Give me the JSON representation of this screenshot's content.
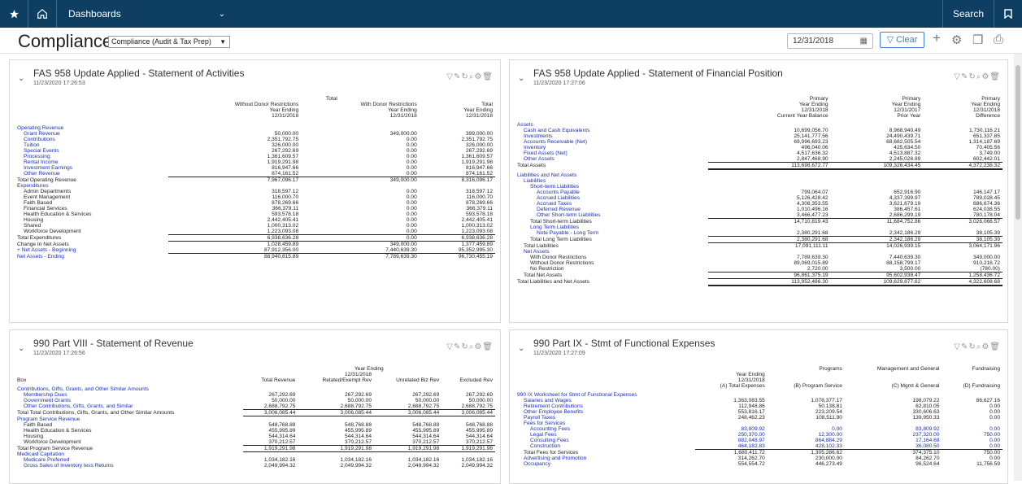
{
  "topbar": {
    "star_icon": "star-icon",
    "home_icon": "home-icon",
    "menu_label": "Dashboards",
    "menu_caret": "⌄",
    "search_label": "Search",
    "bookmark_icon": "bookmark-icon"
  },
  "header": {
    "title": "Compliance",
    "title_caret": "⌄",
    "dashboard_select": "Compliance (Audit & Tax Prep)",
    "date": "12/31/2018",
    "clear_label": "Clear",
    "icons": [
      "add-icon",
      "settings-icon",
      "copy-icon",
      "print-icon"
    ]
  },
  "panels": [
    {
      "title": "FAS 958 Update Applied - Statement of Activities",
      "timestamp": "11/23/2020 17:26:53",
      "group_header": "Total",
      "headers": [
        [
          "",
          "Without Donor Restrictions",
          "With Donor Restrictions",
          "Total"
        ],
        [
          "",
          "Year Ending",
          "Year Ending",
          "Year Ending"
        ],
        [
          "",
          "12/31/2018",
          "12/31/2018",
          "12/31/2018"
        ]
      ],
      "rows": [
        {
          "c": [
            "",
            "",
            " ",
            ""
          ],
          "gap": true
        },
        {
          "c": [
            "Operating Revenue",
            "",
            "",
            ""
          ],
          "i": 0,
          "l": true
        },
        {
          "c": [
            "Grant Revenue",
            "50,000.00",
            "349,000.00",
            "399,000.00"
          ],
          "i": 1,
          "l": true
        },
        {
          "c": [
            "Contributions",
            "2,351,792.75",
            "0.00",
            "2,351,792.75"
          ],
          "i": 1,
          "l": true
        },
        {
          "c": [
            "Tuition",
            "326,000.00",
            "0.00",
            "326,000.00"
          ],
          "i": 1,
          "l": true
        },
        {
          "c": [
            "Special Events",
            "267,292.69",
            "0.00",
            "267,292.69"
          ],
          "i": 1,
          "l": true
        },
        {
          "c": [
            "Processing",
            "1,361,609.57",
            "0.00",
            "1,361,609.57"
          ],
          "i": 1,
          "l": true
        },
        {
          "c": [
            "Rental Income",
            "1,919,291.98",
            "0.00",
            "1,919,291.98"
          ],
          "i": 1,
          "l": true
        },
        {
          "c": [
            "Investment Earnings",
            "816,947.66",
            "0.00",
            "816,947.66"
          ],
          "i": 1,
          "l": true
        },
        {
          "c": [
            "Other Revenue",
            "874,161.52",
            "0.00",
            "874,161.52"
          ],
          "i": 1,
          "l": true,
          "ul": true
        },
        {
          "c": [
            "Total Operating Revenue",
            "7,967,096.17",
            "349,000.00",
            "8,316,096.17"
          ],
          "i": 0
        },
        {
          "c": [
            "Expenditures",
            "",
            "",
            ""
          ],
          "i": 0,
          "l": true
        },
        {
          "c": [
            "Admin Departments",
            "318,597.12",
            "0.00",
            "318,597.12"
          ],
          "i": 1
        },
        {
          "c": [
            "Event Management",
            "116,000.70",
            "0.00",
            "116,000.70"
          ],
          "i": 1
        },
        {
          "c": [
            "Faith Based",
            "878,269.66",
            "0.00",
            "878,269.66"
          ],
          "i": 1
        },
        {
          "c": [
            "Financial Services",
            "366,379.11",
            "0.00",
            "366,379.11"
          ],
          "i": 1
        },
        {
          "c": [
            "Health Education & Services",
            "593,578.18",
            "0.00",
            "593,578.18"
          ],
          "i": 1
        },
        {
          "c": [
            "Housing",
            "2,442,405.41",
            "0.00",
            "2,442,405.41"
          ],
          "i": 1
        },
        {
          "c": [
            "Shared",
            "1,000,313.02",
            "0.00",
            "1,000,313.02"
          ],
          "i": 1
        },
        {
          "c": [
            "Workforce Development",
            "1,223,093.08",
            "0.00",
            "1,223,093.08"
          ],
          "i": 1,
          "ul": true
        },
        {
          "c": [
            "Total Expenditures",
            "6,938,636.28",
            "0.00",
            "6,938,636.28"
          ],
          "i": 0,
          "ul": true
        },
        {
          "c": [
            "Change In Net Assets",
            "1,028,459.89",
            "349,000.00",
            "1,377,459.89"
          ],
          "i": 0
        },
        {
          "c": [
            "+ Net Assets - Beginning",
            "87,912,356.00",
            "7,440,639.30",
            "95,352,995.30"
          ],
          "i": 0,
          "l": true,
          "ul": true
        },
        {
          "c": [
            "Net Assets - Ending",
            "88,940,815.89",
            "7,789,639.30",
            "96,730,455.19"
          ],
          "i": 0,
          "l": true
        }
      ]
    },
    {
      "title": "FAS 958 Update Applied - Statement of Financial Position",
      "timestamp": "11/23/2020 17:27:06",
      "group_header": "",
      "headers": [
        [
          "",
          "Primary",
          "Primary",
          "Primary"
        ],
        [
          "",
          "Year Ending",
          "Year Ending",
          "Year Ending"
        ],
        [
          "",
          "12/31/2018",
          "12/31/2017",
          "12/31/2018"
        ],
        [
          "",
          "Current Year Balance",
          "Prior Year",
          "Difference"
        ]
      ],
      "rows": [
        {
          "c": [
            "Assets",
            "",
            "",
            ""
          ],
          "i": 0,
          "l": true
        },
        {
          "c": [
            "Cash and Cash Equivalents",
            "10,699,056.70",
            "8,968,940.49",
            "1,730,116.21"
          ],
          "i": 1,
          "l": true
        },
        {
          "c": [
            "Investments",
            "25,141,777.56",
            "24,490,439.71",
            "651,337.85"
          ],
          "i": 1,
          "l": true
        },
        {
          "c": [
            "Accounts Receivable (Net)",
            "69,996,693.23",
            "68,682,505.54",
            "1,314,187.69"
          ],
          "i": 1,
          "l": true
        },
        {
          "c": [
            "Inventory",
            "496,040.06",
            "425,634.50",
            "70,405.56"
          ],
          "i": 1,
          "l": true
        },
        {
          "c": [
            "Fixed Assets (Net)",
            "4,517,636.32",
            "4,513,887.32",
            "3,749.00"
          ],
          "i": 1,
          "l": true
        },
        {
          "c": [
            "Other Assets",
            "2,847,468.90",
            "2,245,026.89",
            "602,442.01"
          ],
          "i": 1,
          "l": true,
          "ul": true
        },
        {
          "c": [
            "Total Assets",
            "113,698,672.77",
            "109,326,434.45",
            "4,372,238.32"
          ],
          "i": 0,
          "dl": true
        },
        {
          "c": [
            "",
            "",
            "",
            ""
          ],
          "gap": true
        },
        {
          "c": [
            "Liabilities and Net Assets",
            "",
            "",
            ""
          ],
          "i": 0,
          "l": true
        },
        {
          "c": [
            "Liabilities",
            "",
            "",
            ""
          ],
          "i": 1,
          "l": true
        },
        {
          "c": [
            "Short-term Liabilities",
            "",
            "",
            ""
          ],
          "i": 2,
          "l": true
        },
        {
          "c": [
            "Accounts Payable",
            "799,064.07",
            "652,916.90",
            "146,147.17"
          ],
          "i": 3,
          "l": true
        },
        {
          "c": [
            "Accrued Liabilities",
            "5,126,428.42",
            "4,337,399.97",
            "789,028.45"
          ],
          "i": 3,
          "l": true
        },
        {
          "c": [
            "Accrued Taxes",
            "4,308,353.55",
            "3,621,679.19",
            "686,674.36"
          ],
          "i": 3,
          "l": true
        },
        {
          "c": [
            "Deferred Revenue",
            "1,010,496.16",
            "386,457.61",
            "624,038.55"
          ],
          "i": 3,
          "l": true
        },
        {
          "c": [
            "Other Short-term Liabilities",
            "3,466,477.23",
            "2,686,299.19",
            "780,178.04"
          ],
          "i": 3,
          "l": true,
          "ul": true
        },
        {
          "c": [
            "Total Short-term Liabilities",
            "14,710,819.43",
            "11,684,752.86",
            "3,026,066.57"
          ],
          "i": 2
        },
        {
          "c": [
            "Long Term Liabilities",
            "",
            "",
            ""
          ],
          "i": 2,
          "l": true
        },
        {
          "c": [
            "Note Payable - Long Term",
            "2,380,291.68",
            "2,342,186.29",
            "38,105.39"
          ],
          "i": 3,
          "l": true,
          "ul": true
        },
        {
          "c": [
            "Total Long Term Liabilities",
            "2,380,291.68",
            "2,342,186.29",
            "38,105.39"
          ],
          "i": 2,
          "ul": true
        },
        {
          "c": [
            "Total Liabilities",
            "17,091,111.11",
            "14,026,939.15",
            "3,064,171.96"
          ],
          "i": 1
        },
        {
          "c": [
            "Net Assets",
            "",
            "",
            ""
          ],
          "i": 1,
          "l": true
        },
        {
          "c": [
            "With Donor Restrictions",
            "7,789,639.30",
            "7,440,639.30",
            "349,000.00"
          ],
          "i": 2
        },
        {
          "c": [
            "Without Donor Restrictions",
            "89,069,015.89",
            "88,158,799.17",
            "910,216.72"
          ],
          "i": 2
        },
        {
          "c": [
            "No Restriction",
            "2,720.00",
            "3,500.00",
            "(780.00)"
          ],
          "i": 2,
          "ul": true
        },
        {
          "c": [
            "Total Net Assets",
            "96,861,375.19",
            "95,602,938.47",
            "1,258,436.72"
          ],
          "i": 1,
          "ul": true
        },
        {
          "c": [
            "Total Liabilities and Net Assets",
            "113,952,486.30",
            "109,629,877.62",
            "4,322,608.68"
          ],
          "i": 0,
          "dl": true
        }
      ]
    },
    {
      "title": "990 Part VIII - Statement of Revenue",
      "timestamp": "11/23/2020 17:26:56",
      "group_header": "Year Ending",
      "headers": [
        [
          "",
          "",
          "12/31/2018",
          "",
          ""
        ],
        [
          "",
          "",
          "",
          "",
          ""
        ],
        [
          "Box",
          "Total Revenue",
          "Related/Exempt Rev",
          "Unrelated Biz Rev",
          "Excluded Rev"
        ]
      ],
      "rows": [
        {
          "c": [
            "Contributions, Gifts, Grants, and Other Similar Amounts",
            "",
            "",
            "",
            ""
          ],
          "i": 0,
          "l": true
        },
        {
          "c": [
            "Membership Dues",
            "267,292.69",
            "267,292.69",
            "267,292.69",
            "267,292.69"
          ],
          "i": 1,
          "l": true
        },
        {
          "c": [
            "Government Grants",
            "50,000.00",
            "50,000.00",
            "50,000.00",
            "50,000.00"
          ],
          "i": 1,
          "l": true
        },
        {
          "c": [
            "Other Contributions, Gifts, Grants, and Similar",
            "2,688,792.75",
            "2,688,792.75",
            "2,688,792.75",
            "2,688,792.75"
          ],
          "i": 1,
          "l": true,
          "ul": true
        },
        {
          "c": [
            "Total Total Contributions, Gifts, Grants, and Other Similar Amounts",
            "3,006,085.44",
            "3,006,085.44",
            "3,006,085.44",
            "3,006,085.44"
          ],
          "i": 0,
          "ul": true
        },
        {
          "c": [
            "Program Service Revenue",
            "",
            "",
            "",
            ""
          ],
          "i": 0,
          "l": true
        },
        {
          "c": [
            "Faith Based",
            "548,768.88",
            "548,768.88",
            "548,768.88",
            "548,768.88"
          ],
          "i": 1
        },
        {
          "c": [
            "Health Education & Services",
            "455,995.89",
            "455,995.89",
            "455,995.89",
            "455,995.89"
          ],
          "i": 1
        },
        {
          "c": [
            "Housing",
            "544,314.64",
            "544,314.64",
            "544,314.64",
            "544,314.64"
          ],
          "i": 1
        },
        {
          "c": [
            "Workforce Development",
            "370,212.57",
            "370,212.57",
            "370,212.57",
            "370,212.57"
          ],
          "i": 1,
          "ul": true
        },
        {
          "c": [
            "Total Program Service Revenue",
            "1,919,291.98",
            "1,919,291.98",
            "1,919,291.98",
            "1,919,291.98"
          ],
          "i": 0,
          "ul": true
        },
        {
          "c": [
            "Medicaid Capitation",
            "",
            "",
            "",
            ""
          ],
          "i": 0,
          "l": true
        },
        {
          "c": [
            "Medicare Preferred",
            "1,034,182.16",
            "1,034,182.16",
            "1,034,182.16",
            "1,034,182.16"
          ],
          "i": 1,
          "l": true
        },
        {
          "c": [
            "Gross Sales of Inventory less Returns",
            "2,049,994.32",
            "2,049,994.32",
            "2,049,994.32",
            "2,049,994.32"
          ],
          "i": 1,
          "l": true
        }
      ]
    },
    {
      "title": "990 Part IX - Stmt of Functional Expenses",
      "timestamp": "11/23/2020 17:27:09",
      "group_header": "",
      "headers": [
        [
          "",
          "",
          "Programs",
          "Management and General",
          "Fundraising"
        ],
        [
          "",
          "Year Ending",
          "",
          "",
          ""
        ],
        [
          "",
          "12/31/2018",
          "",
          "",
          ""
        ],
        [
          "",
          "(A) Total Expenses",
          "(B) Program Service",
          "(C) Mgmt & General",
          "(D) Fundraising"
        ]
      ],
      "rows": [
        {
          "c": [
            "990 IX Worksheet for Stmt of Functional Expenses",
            "",
            "",
            "",
            ""
          ],
          "i": 0,
          "l": true
        },
        {
          "c": [
            "Salaries and Wages",
            "1,363,083.55",
            "1,078,377.17",
            "198,079.22",
            "86,627.16"
          ],
          "i": 1,
          "l": true
        },
        {
          "c": [
            "Retirement Contributions",
            "112,948.86",
            "50,138.81",
            "62,810.05",
            "0.00"
          ],
          "i": 1,
          "l": true
        },
        {
          "c": [
            "Other Employee Benefits",
            "553,816.17",
            "223,209.54",
            "330,606.63",
            "0.00"
          ],
          "i": 1,
          "l": true
        },
        {
          "c": [
            "Payroll Taxes",
            "248,462.23",
            "108,511.90",
            "139,950.33",
            "0.00"
          ],
          "i": 1,
          "l": true
        },
        {
          "c": [
            "Fees for Services",
            "",
            "",
            "",
            ""
          ],
          "i": 1,
          "l": true
        },
        {
          "c": [
            "Accounting Fees",
            "83,809.92",
            "0.00",
            "83,809.92",
            "0.00"
          ],
          "i": 2,
          "l": true,
          "bl": true
        },
        {
          "c": [
            "Legal Fees",
            "250,370.00",
            "12,300.00",
            "237,320.00",
            "750.00"
          ],
          "i": 2,
          "l": true,
          "bl": true
        },
        {
          "c": [
            "Consulting Fees",
            "882,048.97",
            "864,884.29",
            "17,164.68",
            "0.00"
          ],
          "i": 2,
          "l": true,
          "bl": true
        },
        {
          "c": [
            "Construction",
            "464,182.83",
            "428,102.33",
            "36,080.50",
            "0.00"
          ],
          "i": 2,
          "l": true,
          "bl": true,
          "ul": true
        },
        {
          "c": [
            "Total Fees for Services",
            "1,680,411.72",
            "1,305,286.62",
            "374,375.10",
            "750.00"
          ],
          "i": 1
        },
        {
          "c": [
            "Advertising and Promotion",
            "314,262.70",
            "230,000.00",
            "84,262.70",
            "0.00"
          ],
          "i": 1,
          "l": true
        },
        {
          "c": [
            "Occupancy",
            "554,554.72",
            "446,273.49",
            "96,524.64",
            "11,756.59"
          ],
          "i": 1,
          "l": true
        }
      ]
    }
  ]
}
